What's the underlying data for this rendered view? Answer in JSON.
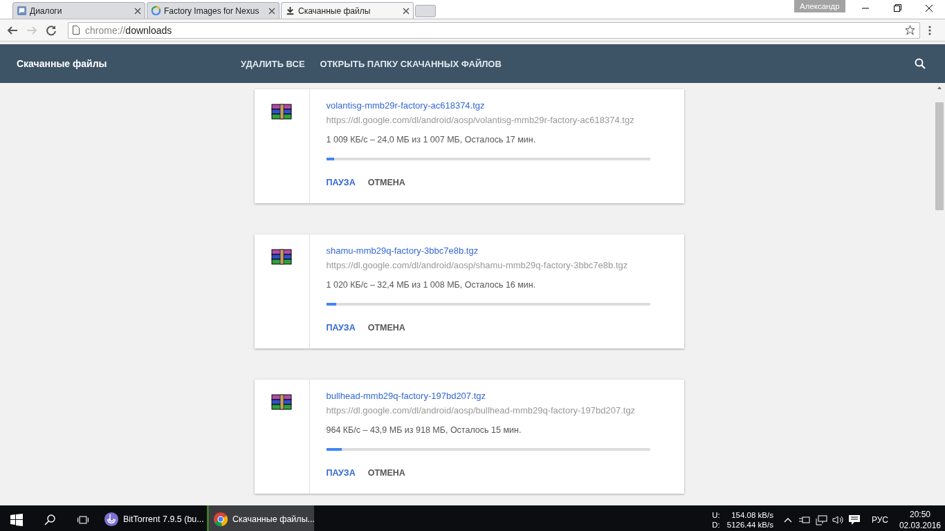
{
  "tabs": [
    {
      "title": "Диалоги",
      "kind": "chat",
      "selected": false
    },
    {
      "title": "Factory Images for Nexus",
      "kind": "site",
      "selected": false
    },
    {
      "title": "Скачанные файлы",
      "kind": "download",
      "selected": true
    }
  ],
  "profile": "Александр",
  "address": {
    "scheme": "chrome://",
    "path": "downloads"
  },
  "header": {
    "title": "Скачанные файлы",
    "actions": [
      "УДАЛИТЬ ВСЕ",
      "ОТКРЫТЬ ПАПКУ СКАЧАННЫХ ФАЙЛОВ"
    ]
  },
  "downloads": [
    {
      "name": "volantisg-mmb29r-factory-ac618374.tgz",
      "url": "https://dl.google.com/dl/android/aosp/volantisg-mmb29r-factory-ac618374.tgz",
      "status": "1 009 КБ/с – 24,0 МБ из 1 007 МБ, Осталось 17 мин.",
      "level": 0.024,
      "actions": [
        "ПАУЗА",
        "ОТМЕНА"
      ]
    },
    {
      "name": "shamu-mmb29q-factory-3bbc7e8b.tgz",
      "url": "https://dl.google.com/dl/android/aosp/shamu-mmb29q-factory-3bbc7e8b.tgz",
      "status": "1 020 КБ/с – 32,4 МБ из 1 008 МБ, Осталось 16 мин.",
      "level": 0.032,
      "actions": [
        "ПАУЗА",
        "ОТМЕНА"
      ]
    },
    {
      "name": "bullhead-mmb29q-factory-197bd207.tgz",
      "url": "https://dl.google.com/dl/android/aosp/bullhead-mmb29q-factory-197bd207.tgz",
      "status": "964 КБ/с – 43,9 МБ из 918 МБ, Осталось 15 мин.",
      "level": 0.048,
      "actions": [
        "ПАУЗА",
        "ОТМЕНА"
      ]
    }
  ],
  "taskbar": {
    "apps": [
      {
        "label": "BitTorrent 7.9.5  (bu...",
        "kind": "torrent",
        "selected": false
      },
      {
        "label": "Скачанные файлы...",
        "kind": "chrome",
        "selected": true
      }
    ],
    "net": {
      "up_label": "U:",
      "up": "154.08 kB/s",
      "down_label": "D:",
      "down": "5126.44 kB/s"
    },
    "lang": "РУС",
    "time": "20:50",
    "date": "02.03.2016"
  }
}
